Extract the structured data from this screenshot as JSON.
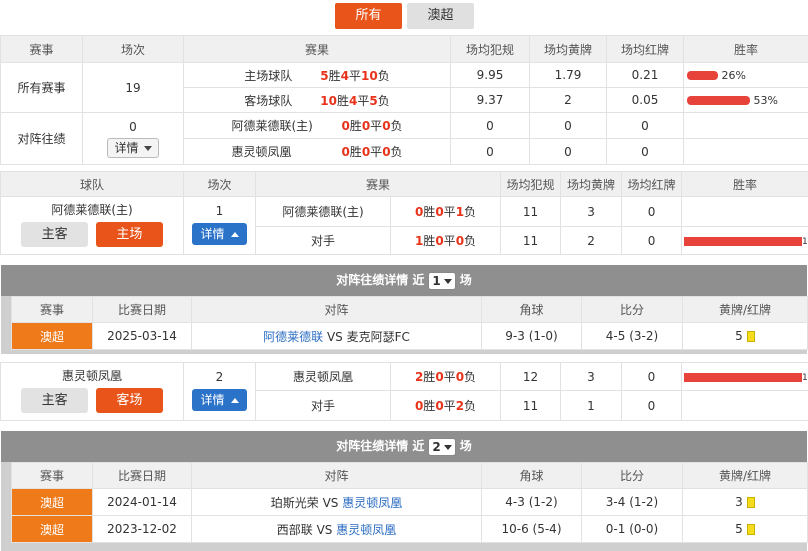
{
  "tabs": [
    "所有",
    "澳超"
  ],
  "summary": {
    "headers": [
      "赛事",
      "场次",
      "赛果",
      "场均犯规",
      "场均黄牌",
      "场均红牌",
      "胜率"
    ],
    "all_label": "所有赛事",
    "all_count": "19",
    "home": {
      "label": "主场球队",
      "w": "5",
      "d": "4",
      "l": "10",
      "fouls": "9.95",
      "yellow": "1.79",
      "red": "0.21",
      "rate": "26%",
      "rate_value": 0.26
    },
    "away": {
      "label": "客场球队",
      "w": "10",
      "d": "4",
      "l": "5",
      "fouls": "9.37",
      "yellow": "2",
      "red": "0.05",
      "rate": "53%",
      "rate_value": 0.53
    },
    "h2h_label": "对阵往绩",
    "h2h_count": "0",
    "detail_label": "详情",
    "h2h_home": {
      "label": "阿德莱德联(主)",
      "w": "0",
      "d": "0",
      "l": "0",
      "fouls": "0",
      "yellow": "0",
      "red": "0"
    },
    "h2h_away": {
      "label": "惠灵顿凤凰",
      "w": "0",
      "d": "0",
      "l": "0",
      "fouls": "0",
      "yellow": "0",
      "red": "0"
    }
  },
  "units": {
    "win": "胜",
    "draw": "平",
    "loss": "负"
  },
  "team_section": {
    "headers": [
      "球队",
      "场次",
      "赛果",
      "场均犯规",
      "场均黄牌",
      "场均红牌",
      "胜率"
    ],
    "btn_host_away": "主客",
    "btn_home": "主场",
    "btn_away": "客场",
    "detail_label": "详情",
    "team1": {
      "name": "阿德莱德联(主)",
      "count": "1",
      "row1": {
        "label": "阿德莱德联(主)",
        "w": "0",
        "d": "0",
        "l": "1",
        "fouls": "11",
        "yellow": "3",
        "red": "0",
        "rate_value": 0
      },
      "row2": {
        "label": "对手",
        "w": "1",
        "d": "0",
        "l": "0",
        "fouls": "11",
        "yellow": "2",
        "red": "0",
        "rate_value": 1,
        "edge": "1"
      }
    },
    "team2": {
      "name": "惠灵顿凤凰",
      "count": "2",
      "row1": {
        "label": "惠灵顿凤凰",
        "w": "2",
        "d": "0",
        "l": "0",
        "fouls": "12",
        "yellow": "3",
        "red": "0",
        "rate_value": 1,
        "edge": "1"
      },
      "row2": {
        "label": "对手",
        "w": "0",
        "d": "0",
        "l": "2",
        "fouls": "11",
        "yellow": "1",
        "red": "0",
        "rate_value": 0
      }
    }
  },
  "panel1": {
    "title_pre": "对阵往绩详情 近",
    "n": "1",
    "title_post": "场",
    "headers": [
      "赛事",
      "比赛日期",
      "对阵",
      "角球",
      "比分",
      "黄牌/红牌"
    ],
    "rows": [
      {
        "league": "澳超",
        "date": "2025-03-14",
        "home": "阿德莱德联",
        "vs": "VS",
        "away": "麦克阿瑟FC",
        "corner": "9-3 (1-0)",
        "score": "4-5 (3-2)",
        "cards": "5"
      }
    ]
  },
  "panel2": {
    "title_pre": "对阵往绩详情 近",
    "n": "2",
    "title_post": "场",
    "headers": [
      "赛事",
      "比赛日期",
      "对阵",
      "角球",
      "比分",
      "黄牌/红牌"
    ],
    "rows": [
      {
        "league": "澳超",
        "date": "2024-01-14",
        "home": "珀斯光荣",
        "vs": "VS",
        "away": "惠灵顿凤凰",
        "corner": "4-3 (1-2)",
        "score": "3-4 (1-2)",
        "cards": "3"
      },
      {
        "league": "澳超",
        "date": "2023-12-02",
        "home": "西部联",
        "vs": "VS",
        "away": "惠灵顿凤凰",
        "corner": "10-6 (5-4)",
        "score": "0-1 (0-0)",
        "cards": "5"
      }
    ]
  },
  "colors": {
    "accent": "#e8541a",
    "win_red": "#e8321a",
    "bar": "#e8433a",
    "link": "#2b6cc2",
    "league": "#ef7a1a",
    "blue_btn": "#2b73c9"
  }
}
